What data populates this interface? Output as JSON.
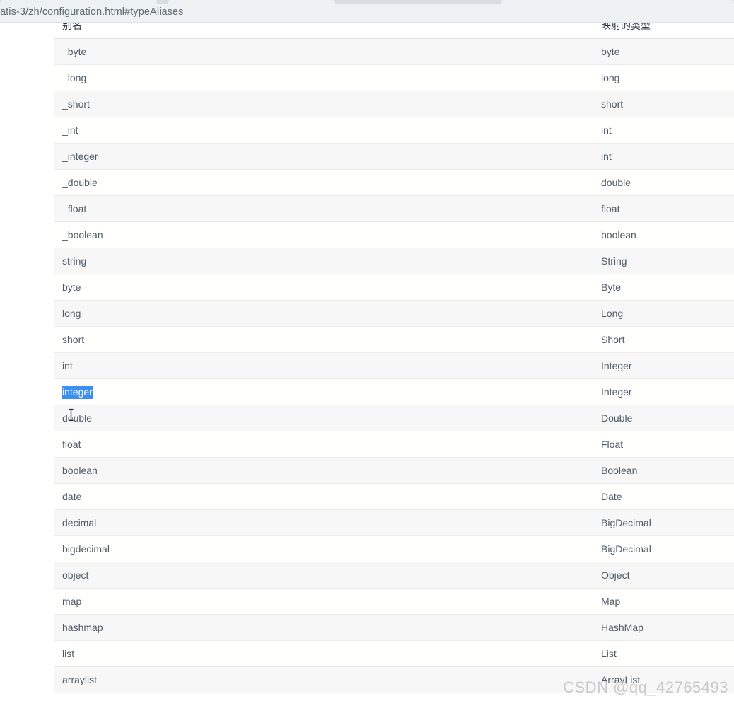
{
  "browser": {
    "url_text": "atis-3/zh/configuration.html#typeAliases",
    "tabs": [
      {
        "label": ""
      },
      {
        "label": ""
      },
      {
        "label": ""
      }
    ]
  },
  "table": {
    "headers": {
      "alias": "别名",
      "mapped_type": "映射的类型"
    },
    "selected_alias": "integer",
    "rows": [
      {
        "alias": "_byte",
        "type": "byte"
      },
      {
        "alias": "_long",
        "type": "long"
      },
      {
        "alias": "_short",
        "type": "short"
      },
      {
        "alias": "_int",
        "type": "int"
      },
      {
        "alias": "_integer",
        "type": "int"
      },
      {
        "alias": "_double",
        "type": "double"
      },
      {
        "alias": "_float",
        "type": "float"
      },
      {
        "alias": "_boolean",
        "type": "boolean"
      },
      {
        "alias": "string",
        "type": "String"
      },
      {
        "alias": "byte",
        "type": "Byte"
      },
      {
        "alias": "long",
        "type": "Long"
      },
      {
        "alias": "short",
        "type": "Short"
      },
      {
        "alias": "int",
        "type": "Integer"
      },
      {
        "alias": "integer",
        "type": "Integer"
      },
      {
        "alias": "double",
        "type": "Double"
      },
      {
        "alias": "float",
        "type": "Float"
      },
      {
        "alias": "boolean",
        "type": "Boolean"
      },
      {
        "alias": "date",
        "type": "Date"
      },
      {
        "alias": "decimal",
        "type": "BigDecimal"
      },
      {
        "alias": "bigdecimal",
        "type": "BigDecimal"
      },
      {
        "alias": "object",
        "type": "Object"
      },
      {
        "alias": "map",
        "type": "Map"
      },
      {
        "alias": "hashmap",
        "type": "HashMap"
      },
      {
        "alias": "list",
        "type": "List"
      },
      {
        "alias": "arraylist",
        "type": "ArrayList"
      }
    ]
  },
  "watermark": {
    "text": "CSDN @qq_42765493"
  },
  "colors": {
    "selection_blue": "#3b8ff0",
    "row_stripe": "#f7f7f7",
    "text": "#4d5a66",
    "urlbar_bg": "#eef2f3",
    "watermark": "#c9c9c9"
  }
}
